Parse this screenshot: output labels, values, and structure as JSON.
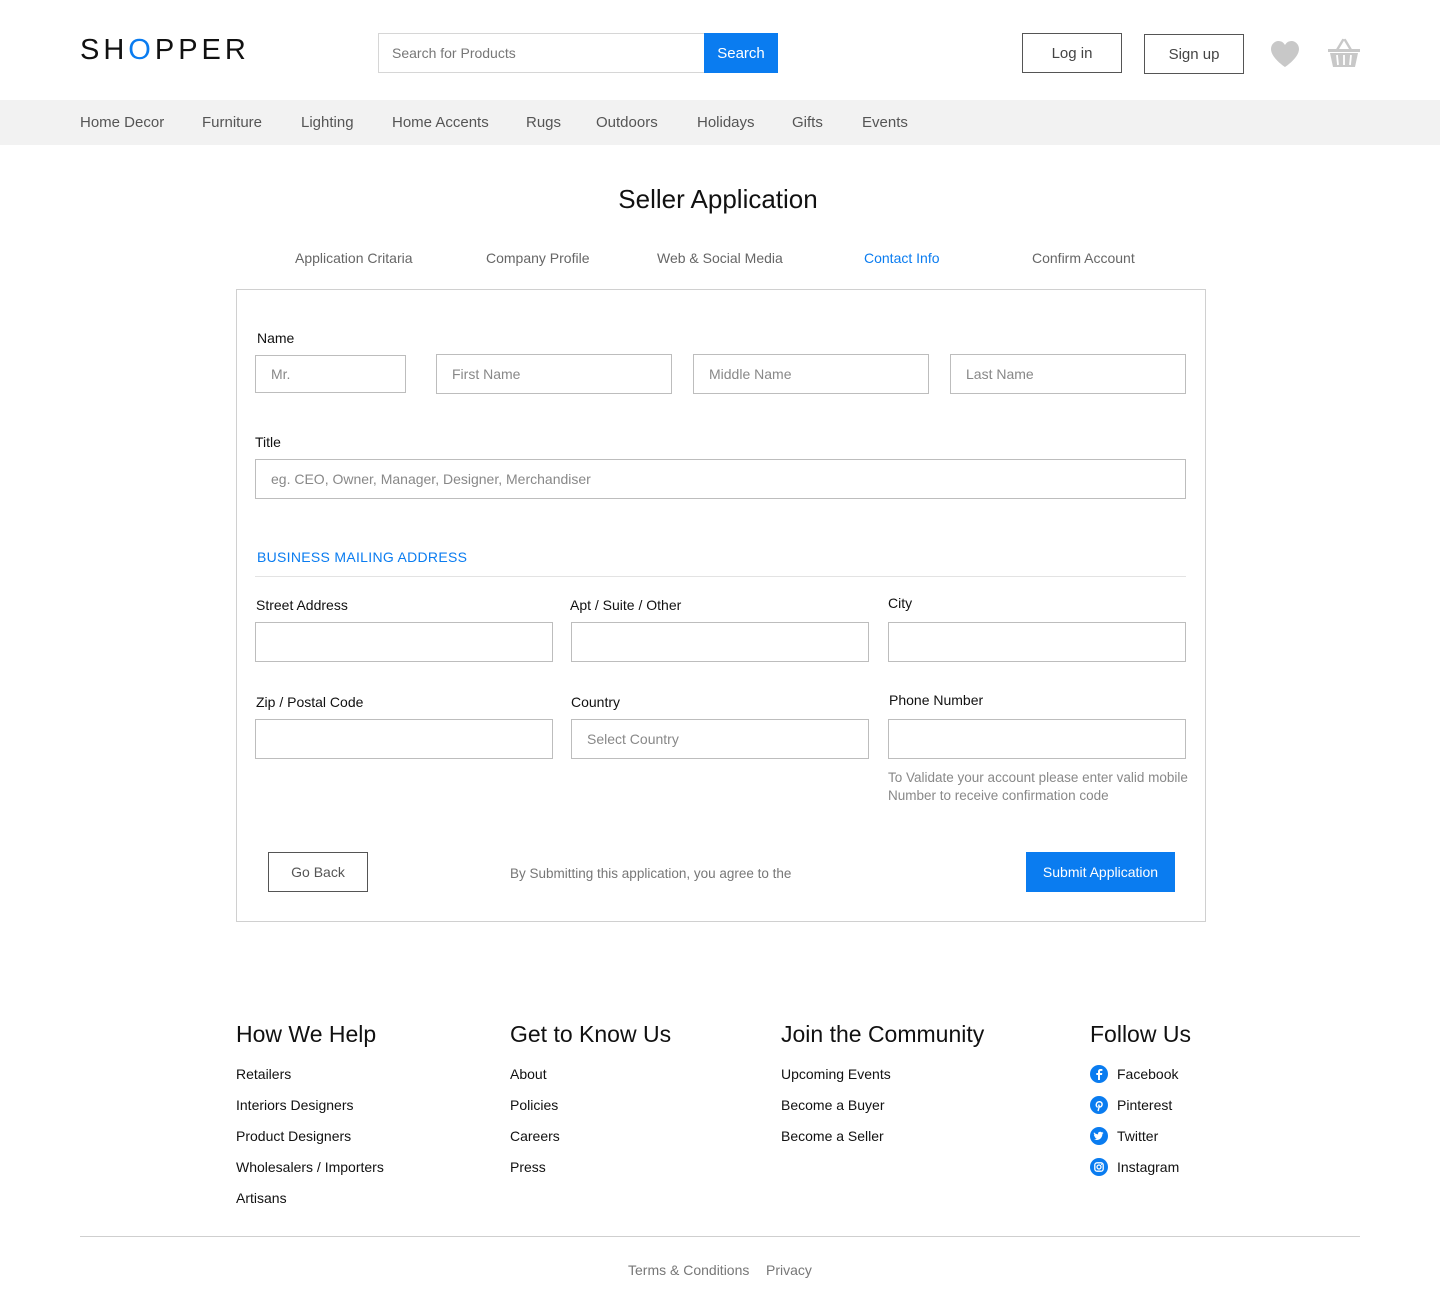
{
  "header": {
    "logo_pre": "SH",
    "logo_o": "O",
    "logo_post": "PPER",
    "search_placeholder": "Search for Products",
    "search_button": "Search",
    "login": "Log in",
    "signup": "Sign up",
    "wishlist_icon": "heart-icon",
    "cart_icon": "basket-icon"
  },
  "categories": [
    "Home Decor",
    "Furniture",
    "Lighting",
    "Home Accents",
    "Rugs",
    "Outdoors",
    "Holidays",
    "Gifts",
    "Events"
  ],
  "page": {
    "title": "Seller Application",
    "steps": [
      {
        "label": "Application Critaria",
        "active": false
      },
      {
        "label": "Company Profile",
        "active": false
      },
      {
        "label": "Web & Social Media",
        "active": false
      },
      {
        "label": "Contact Info",
        "active": true
      },
      {
        "label": "Confirm Account",
        "active": false
      }
    ]
  },
  "form": {
    "name_label": "Name",
    "salutation_placeholder": "Mr.",
    "first_name_placeholder": "First Name",
    "middle_name_placeholder": "Middle Name",
    "last_name_placeholder": "Last Name",
    "title_label": "Title",
    "title_placeholder": "eg. CEO, Owner, Manager, Designer, Merchandiser",
    "address_section": "BUSINESS MAILING ADDRESS",
    "street_label": "Street Address",
    "apt_label": "Apt / Suite / Other",
    "city_label": "City",
    "zip_label": "Zip / Postal Code",
    "country_label": "Country",
    "country_selected": "Select Country",
    "phone_label": "Phone Number",
    "phone_hint": "To Validate your account please enter valid mobile Number to receive confirmation code",
    "go_back": "Go Back",
    "agree_text": "By Submitting this application, you agree to the",
    "submit": "Submit Application"
  },
  "footer": {
    "columns": [
      {
        "heading": "How We Help",
        "links": [
          "Retailers",
          "Interiors Designers",
          "Product Designers",
          "Wholesalers / Importers",
          "Artisans"
        ]
      },
      {
        "heading": "Get to Know Us",
        "links": [
          "About",
          "Policies",
          "Careers",
          "Press"
        ]
      },
      {
        "heading": "Join the Community",
        "links": [
          "Upcoming Events",
          "Become a Buyer",
          "Become a Seller"
        ]
      }
    ],
    "follow": {
      "heading": "Follow Us",
      "links": [
        {
          "label": "Facebook",
          "icon": "facebook-icon"
        },
        {
          "label": "Pinterest",
          "icon": "pinterest-icon"
        },
        {
          "label": "Twitter",
          "icon": "twitter-icon"
        },
        {
          "label": "Instagram",
          "icon": "instagram-icon"
        }
      ]
    },
    "legal": [
      "Terms & Conditions",
      "Privacy"
    ]
  },
  "colors": {
    "accent": "#0a7cf0",
    "nav_background": "#f2f2f2",
    "icon_gray": "#c8c8c8"
  }
}
